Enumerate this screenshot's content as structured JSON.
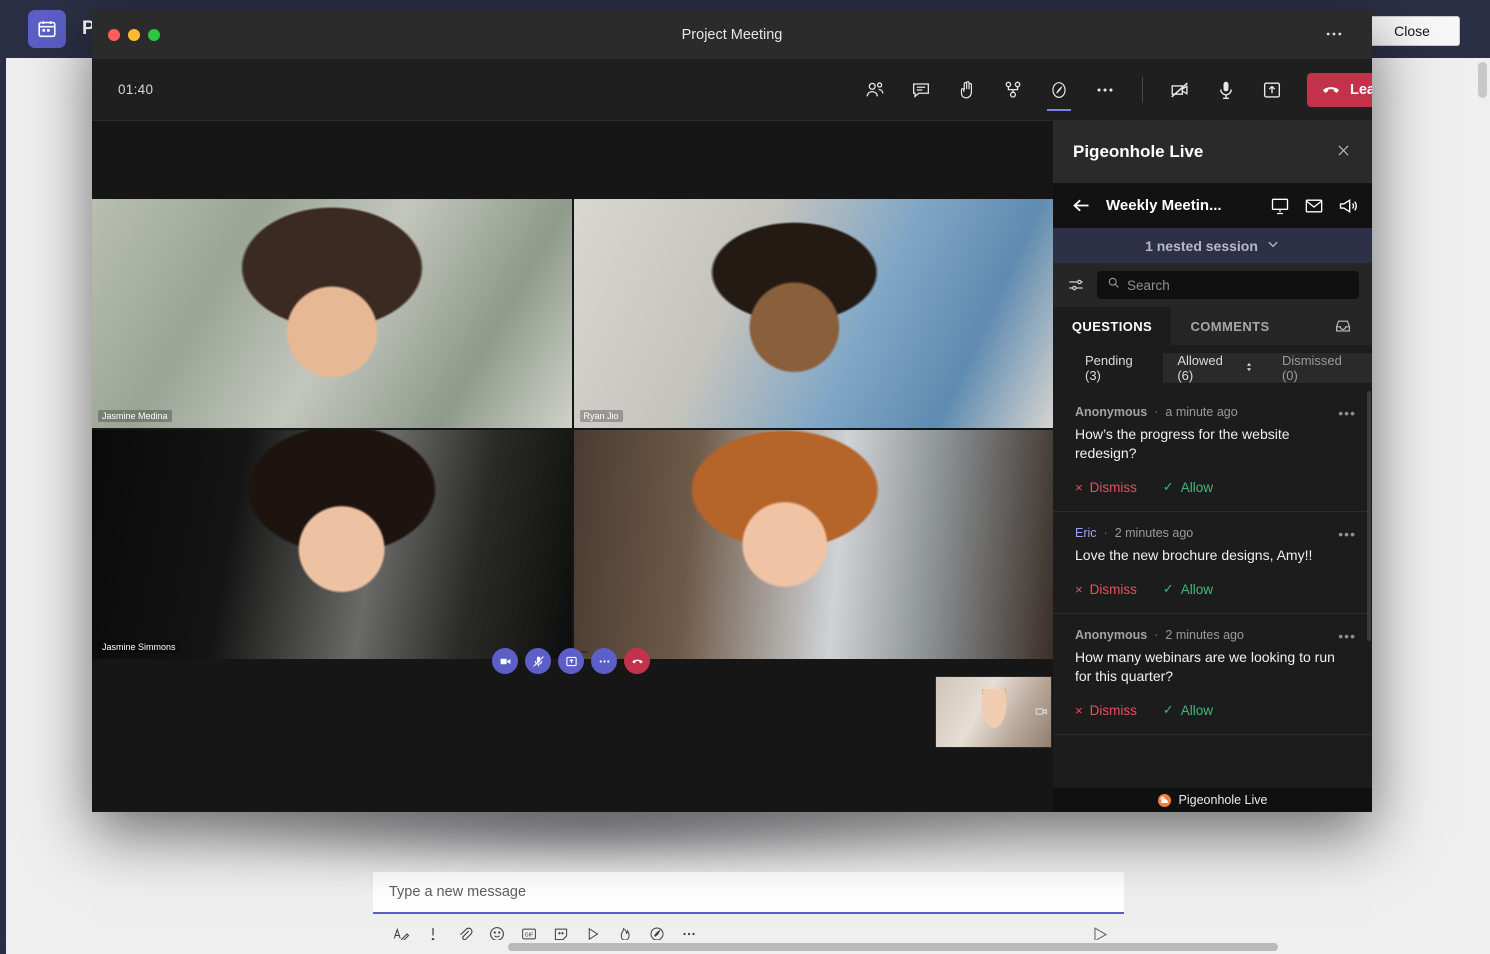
{
  "background_app": {
    "title": "Project Meeting",
    "icon": "calendar-icon",
    "close_label": "Close",
    "accent_color": "#5b5fc7",
    "titlebar_color": "#2b2f45",
    "compose": {
      "placeholder": "Type a new message",
      "value": "",
      "toolbar_icons": [
        "format-text-icon",
        "important-icon",
        "attach-icon",
        "emoji-icon",
        "gif-icon",
        "sticker-icon",
        "stream-icon",
        "praise-icon",
        "pigeonhole-icon",
        "more-options-icon"
      ],
      "send_icon": "send-icon"
    }
  },
  "meeting_window": {
    "title": "Project Meeting",
    "traffic_lights": [
      "close",
      "minimize",
      "zoom"
    ],
    "more_icon": "more-options-icon",
    "timer": "01:40",
    "toolbar": {
      "icons": [
        {
          "name": "people-icon",
          "active": false
        },
        {
          "name": "chat-icon",
          "active": false
        },
        {
          "name": "raise-hand-icon",
          "active": false
        },
        {
          "name": "breakout-rooms-icon",
          "active": false
        },
        {
          "name": "pigeonhole-app-icon",
          "active": true
        },
        {
          "name": "more-options-icon",
          "active": false
        }
      ],
      "device_icons": [
        "camera-off-icon",
        "microphone-icon",
        "share-screen-icon"
      ],
      "leave_label": "Leave",
      "leave_color": "#c4314b",
      "leave_caret_icon": "chevron-down-icon"
    },
    "video_grid": [
      {
        "name": "Jasmine Medina"
      },
      {
        "name": "Ryan Jio"
      },
      {
        "name": "Jasmine Simmons"
      },
      {
        "name": ""
      }
    ],
    "inner_controls": [
      "camera-icon",
      "mic-muted-icon",
      "share-icon",
      "more-icon",
      "hang-up-icon"
    ],
    "pip_icon": "camera-icon"
  },
  "panel": {
    "title": "Pigeonhole Live",
    "close_icon": "close-icon",
    "back_icon": "back-arrow-icon",
    "session_name": "Weekly Meetin...",
    "header_icons": [
      "present-icon",
      "mail-icon",
      "broadcast-icon"
    ],
    "nested_session": {
      "label": "1 nested session",
      "caret_icon": "chevron-down-icon",
      "bg_color": "#2e3048"
    },
    "search": {
      "placeholder": "Search",
      "value": "",
      "search_icon": "search-icon",
      "filter_icon": "filter-sliders-icon"
    },
    "tabs": [
      {
        "label": "QUESTIONS",
        "selected": true
      },
      {
        "label": "COMMENTS",
        "selected": false
      }
    ],
    "inbox_icon": "archive-inbox-icon",
    "filters": [
      {
        "label": "Pending (3)",
        "style": "plain"
      },
      {
        "label": "Allowed (6)",
        "style": "boxed",
        "sort_icon": "sort-updown-icon"
      },
      {
        "label": "Dismissed (0)",
        "style": "boxed-muted"
      }
    ],
    "questions": [
      {
        "author": "Anonymous",
        "anonymous": true,
        "separator": "·",
        "time": "a minute ago",
        "more_icon": "more-options-icon",
        "text": "How’s the progress for the website redesign?",
        "dismiss_label": "Dismiss",
        "allow_label": "Allow",
        "dismiss_glyph": "×",
        "allow_glyph": "✓"
      },
      {
        "author": "Eric",
        "anonymous": false,
        "separator": "·",
        "time": "2 minutes ago",
        "more_icon": "more-options-icon",
        "text": "Love the new brochure designs, Amy!!",
        "dismiss_label": "Dismiss",
        "allow_label": "Allow",
        "dismiss_glyph": "×",
        "allow_glyph": "✓"
      },
      {
        "author": "Anonymous",
        "anonymous": true,
        "separator": "·",
        "time": "2 minutes ago",
        "more_icon": "more-options-icon",
        "text": "How many webinars are we looking to run for this quarter?",
        "dismiss_label": "Dismiss",
        "allow_label": "Allow",
        "dismiss_glyph": "×",
        "allow_glyph": "✓"
      }
    ],
    "footer": {
      "brand": "Pigeonhole Live",
      "logo": "pigeonhole-logo-icon",
      "logo_color": "#f2803b"
    }
  },
  "colors": {
    "dismiss": "#e8505b",
    "allow": "#3fb97a",
    "name_link": "#9da2ee",
    "teams_purple": "#5b5fc7"
  }
}
